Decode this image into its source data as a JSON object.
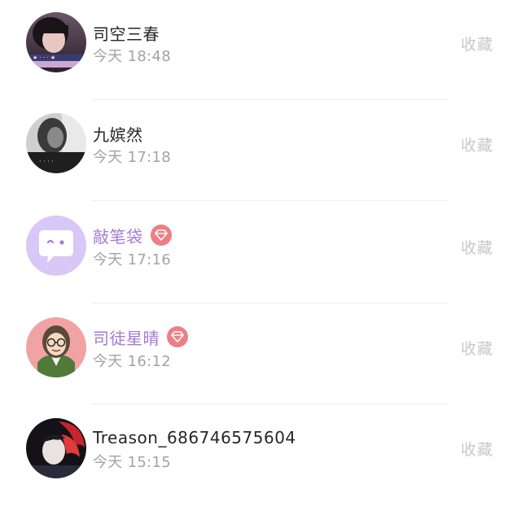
{
  "favorite_label": "收藏",
  "time_prefix": "今天",
  "colors": {
    "vip_name": "#a57ad6",
    "vip_badge": "#ee7e86",
    "name": "#262626",
    "time": "#a3a3a3",
    "action": "#c8c8c8"
  },
  "contacts": [
    {
      "name": "司空三春",
      "time": "今天 18:48",
      "vip": false,
      "avatar_icon": "portrait-photo"
    },
    {
      "name": "九嫔然",
      "time": "今天 17:18",
      "vip": false,
      "avatar_icon": "grayscale-portrait-photo"
    },
    {
      "name": "敲笔袋",
      "time": "今天 17:16",
      "vip": true,
      "avatar_icon": "chat-bubble-face-icon"
    },
    {
      "name": "司徒星晴",
      "time": "今天 16:12",
      "vip": true,
      "avatar_icon": "cartoon-girl-glasses"
    },
    {
      "name": "Treason_686746575604",
      "time": "今天 15:15",
      "vip": false,
      "avatar_icon": "anime-red-hair"
    }
  ]
}
